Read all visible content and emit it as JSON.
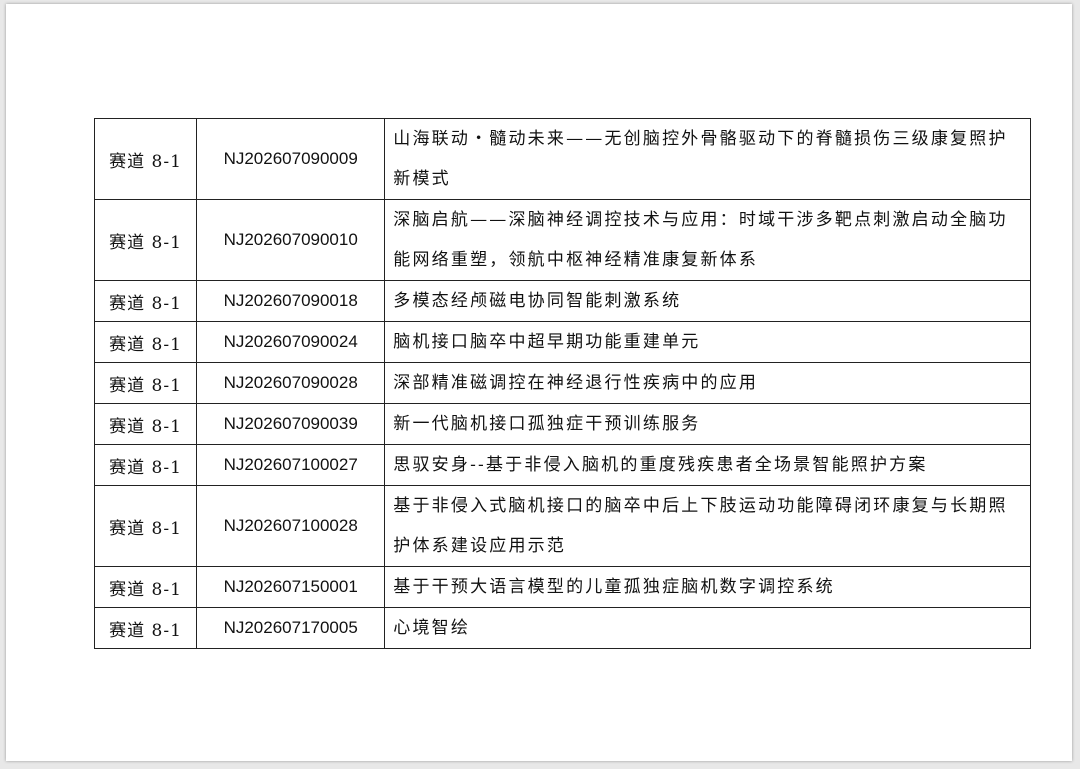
{
  "rows": [
    {
      "track": "赛道 8-1",
      "code": "NJ202607090009",
      "title": "山海联动・髓动未来——无创脑控外骨骼驱动下的脊髓损伤三级康复照护新模式"
    },
    {
      "track": "赛道 8-1",
      "code": "NJ202607090010",
      "title": "深脑启航——深脑神经调控技术与应用：时域干涉多靶点刺激启动全脑功能网络重塑，领航中枢神经精准康复新体系"
    },
    {
      "track": "赛道 8-1",
      "code": "NJ202607090018",
      "title": "多模态经颅磁电协同智能刺激系统"
    },
    {
      "track": "赛道 8-1",
      "code": "NJ202607090024",
      "title": "脑机接口脑卒中超早期功能重建单元"
    },
    {
      "track": "赛道 8-1",
      "code": "NJ202607090028",
      "title": "深部精准磁调控在神经退行性疾病中的应用"
    },
    {
      "track": "赛道 8-1",
      "code": "NJ202607090039",
      "title": "新一代脑机接口孤独症干预训练服务"
    },
    {
      "track": "赛道 8-1",
      "code": "NJ202607100027",
      "title": "思驭安身--基于非侵入脑机的重度残疾患者全场景智能照护方案"
    },
    {
      "track": "赛道 8-1",
      "code": "NJ202607100028",
      "title": "基于非侵入式脑机接口的脑卒中后上下肢运动功能障碍闭环康复与长期照护体系建设应用示范"
    },
    {
      "track": "赛道 8-1",
      "code": "NJ202607150001",
      "title": "基于干预大语言模型的儿童孤独症脑机数字调控系统"
    },
    {
      "track": "赛道 8-1",
      "code": "NJ202607170005",
      "title": "心境智绘"
    }
  ]
}
